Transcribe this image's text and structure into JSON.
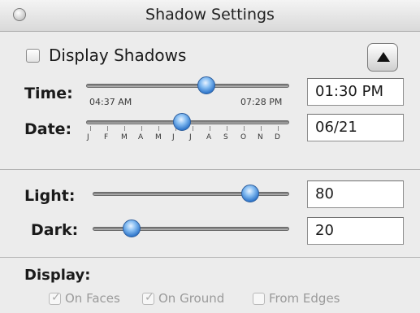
{
  "window": {
    "title": "Shadow Settings"
  },
  "display_shadows": {
    "label": "Display Shadows",
    "checked": false
  },
  "time": {
    "label": "Time:",
    "start_label": "04:37 AM",
    "end_label": "07:28 PM",
    "value": "01:30 PM",
    "slider_fraction": 0.59
  },
  "date": {
    "label": "Date:",
    "months": [
      "J",
      "F",
      "M",
      "A",
      "M",
      "J",
      "J",
      "A",
      "S",
      "O",
      "N",
      "D"
    ],
    "value": "06/21",
    "slider_fraction": 0.47
  },
  "light": {
    "label": "Light:",
    "value": "80",
    "slider_fraction": 0.8
  },
  "dark": {
    "label": "Dark:",
    "value": "20",
    "slider_fraction": 0.2
  },
  "display": {
    "label": "Display:",
    "options": [
      {
        "label": "On Faces",
        "checked": true,
        "enabled": false
      },
      {
        "label": "On Ground",
        "checked": true,
        "enabled": false
      },
      {
        "label": "From Edges",
        "checked": false,
        "enabled": false
      }
    ]
  },
  "icons": {
    "close": "close-icon",
    "collapse": "triangle-up-icon"
  }
}
